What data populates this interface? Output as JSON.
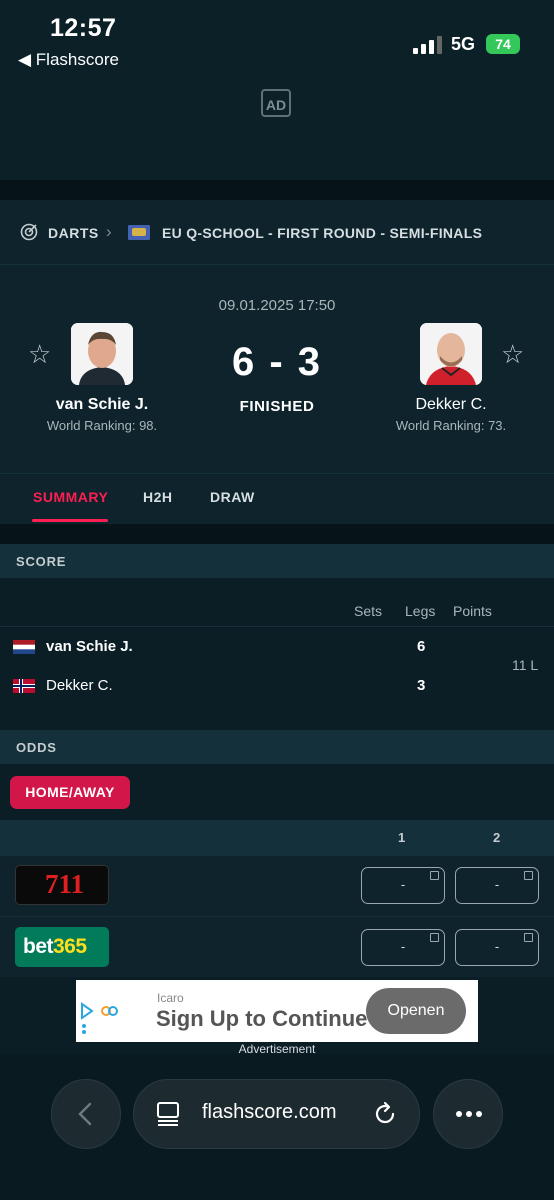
{
  "status_bar": {
    "time": "12:57",
    "back_label": "◀ Flashscore",
    "network": "5G",
    "battery": "74"
  },
  "ad_top": {
    "badge": "AD"
  },
  "breadcrumb": {
    "sport": "DARTS",
    "competition": "EU Q-SCHOOL - FIRST ROUND - SEMI-FINALS"
  },
  "match": {
    "datetime": "09.01.2025 17:50",
    "score": "6 - 3",
    "status": "FINISHED",
    "home": {
      "name": "van Schie J.",
      "ranking": "World Ranking: 98."
    },
    "away": {
      "name": "Dekker C.",
      "ranking": "World Ranking: 73."
    }
  },
  "tabs": [
    {
      "label": "SUMMARY",
      "active": true
    },
    {
      "label": "H2H"
    },
    {
      "label": "DRAW"
    }
  ],
  "score_section": {
    "title": "SCORE",
    "columns": [
      "Sets",
      "Legs",
      "Points"
    ],
    "rows": [
      {
        "name": "van Schie J.",
        "legs": "6",
        "flag": "netherlands-flag",
        "winner": true
      },
      {
        "name": "Dekker C.",
        "legs": "3",
        "flag": "norway-flag",
        "winner": false
      }
    ],
    "extra": "11 L"
  },
  "odds": {
    "title": "ODDS",
    "tab": "HOME/AWAY",
    "columns": [
      "1",
      "2"
    ],
    "bookmakers": [
      {
        "name": "711",
        "odd1": "-",
        "odd2": "-"
      },
      {
        "name": "bet365",
        "odd1": "-",
        "odd2": "-"
      }
    ]
  },
  "banner": {
    "brand": "Icaro",
    "headline": "Sign Up to Continue",
    "cta": "Openen",
    "label": "Advertisement"
  },
  "browser": {
    "url": "flashscore.com"
  },
  "colors": {
    "accent": "#ff1e52",
    "background": "#0b1e26",
    "bet365_green": "#027b5b",
    "bet365_yellow": "#ffdf1b"
  }
}
